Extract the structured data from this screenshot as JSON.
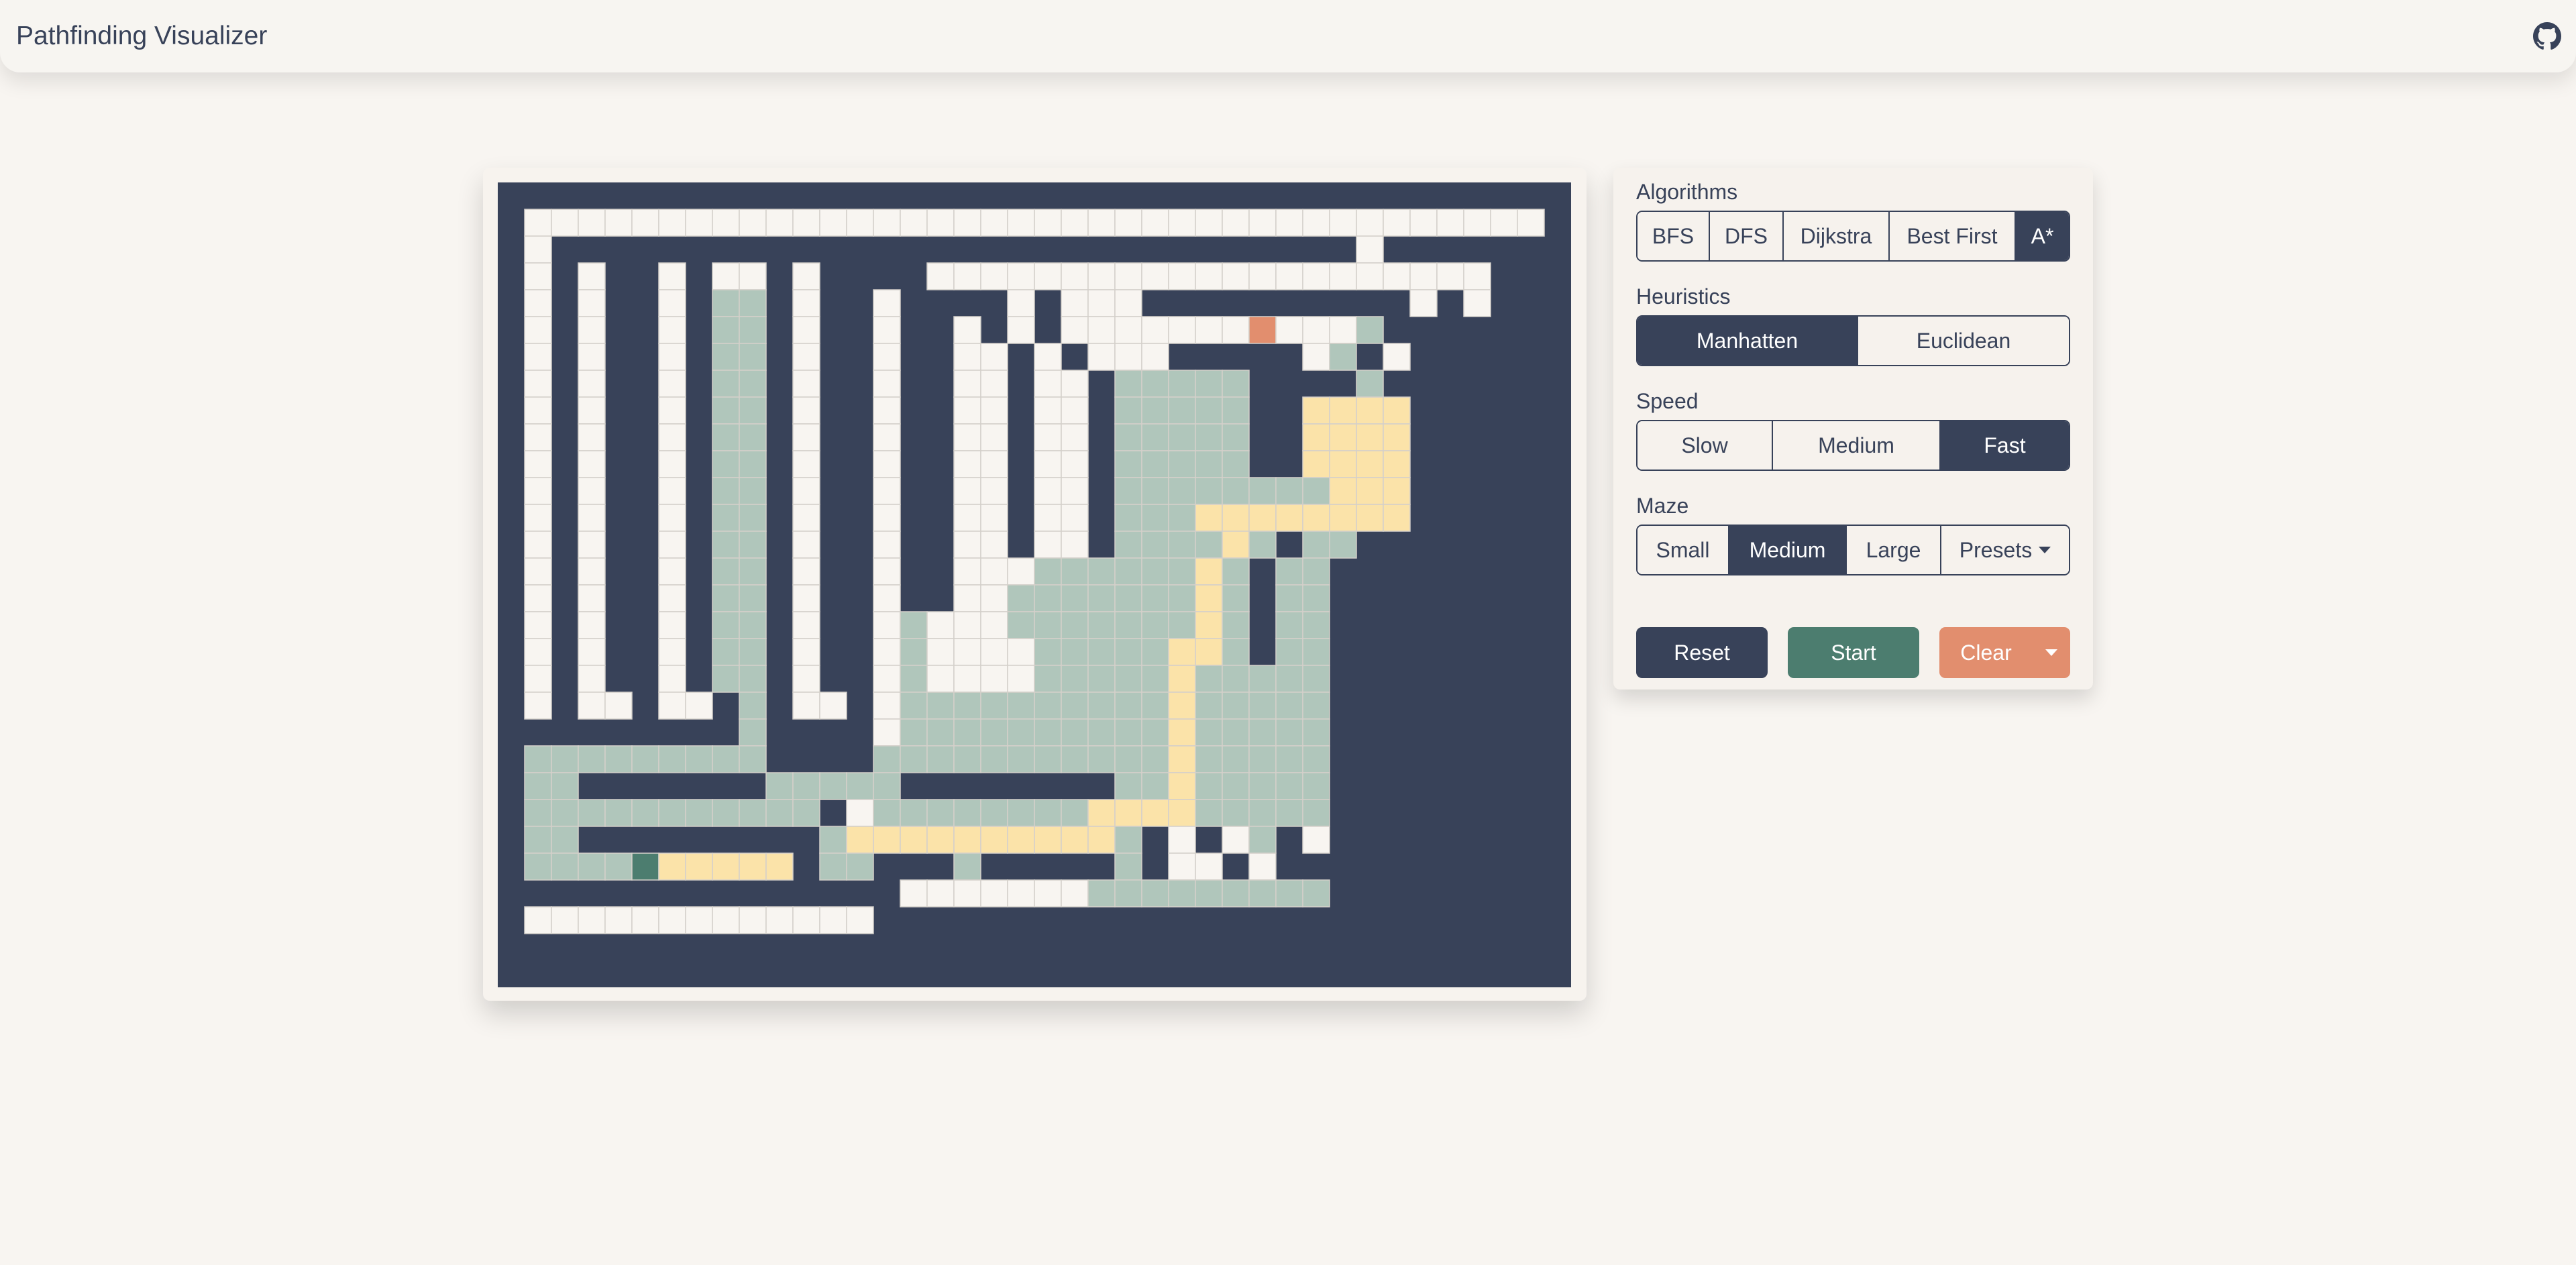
{
  "app": {
    "title": "Pathfinding Visualizer",
    "github_icon": "github-icon"
  },
  "controls": {
    "algorithms": {
      "label": "Algorithms",
      "options": [
        "BFS",
        "DFS",
        "Dijkstra",
        "Best First",
        "A*"
      ],
      "selected": "A*"
    },
    "heuristics": {
      "label": "Heuristics",
      "options": [
        "Manhatten",
        "Euclidean"
      ],
      "selected": "Manhatten"
    },
    "speed": {
      "label": "Speed",
      "options": [
        "Slow",
        "Medium",
        "Fast"
      ],
      "selected": "Fast"
    },
    "maze": {
      "label": "Maze",
      "options": [
        "Small",
        "Medium",
        "Large",
        "Presets"
      ],
      "selected": "Medium"
    },
    "actions": {
      "reset": "Reset",
      "start": "Start",
      "clear": "Clear"
    }
  },
  "colors": {
    "wall": "#384259",
    "empty": "#f8f5f1",
    "visited": "#b0c6bb",
    "path": "#fbe3a9",
    "start": "#4c7d6f",
    "target": "#e28e6e",
    "accent_dark": "#384259",
    "accent_green": "#4c7d6f",
    "accent_orange": "#e28e6e"
  },
  "grid": {
    "cols": 40,
    "rows": 30,
    "legend": {
      "#": "wall",
      ".": "empty",
      "v": "visited",
      "p": "path",
      "S": "start",
      "T": "target"
    },
    "map": [
      "########################################",
      "#......................................#",
      "#.##############################.######",
      "#.#.##.#..#.####.....................###",
      "#.#.##.#vv#.##.####.#...##########.#.###",
      "#.#.##.#vv#.##.##.#.#.......T...v######",
      "#.#.##.#vv#.##.##..#.#...#####.v#.######",
      "#.#.##.#vv#.##.##..#..#vvvvv####v#######",
      "#.#.##.#vv#.##.##..#..#vvvvv##pppp######",
      "#.#.##.#vv#.##.##..#..#vvvvv##pppp######",
      "#.#.##.#vv#.##.##..#..#vvvvv##pppp######",
      "#.#.##.#vv#.##.##..#..#vvvvvvvvppp######",
      "#.#.##.#vv#.##.##..#..#vvvpppppppp######",
      "#.#.##.#vv#.##.##..#..#vvvvpv#vv########",
      "#.#.##.#vv#.##.##...vvvvvvpv#vv#########",
      "#.#.##.#vv#.##.##..vvvvvvvpv#vv#########",
      "#.#.##.#vv#.##.v...vvvvvvvpv#vv#########",
      "#.#.##.#vv#.##.v....vvvvvppv#vv#########",
      "#.#.##.#vv#.##.v....vvvvvpvvvvv#########",
      "#.#..#..#v#..#.vvvvvvvvvvpvvvvv#########",
      "#########v####.vvvvvvvvvvpvvvvv#########",
      "#vvvvvvvvv####vvvvvvvvvvvpvvvvv#########",
      "#vv#######vvvvv########vvpvvvvv#########",
      "#vvvvvvvvvvv#.vvvvvvvvppppvvvvv#########",
      "#vv#########vppppppppppv#.#.v#.#########",
      "#vvvvSppppp#vv###v#####v#..#.##########",
      "###############.......vvvvvvvvv#########",
      "#.............#########################",
      "########################################",
      "########################################"
    ]
  }
}
